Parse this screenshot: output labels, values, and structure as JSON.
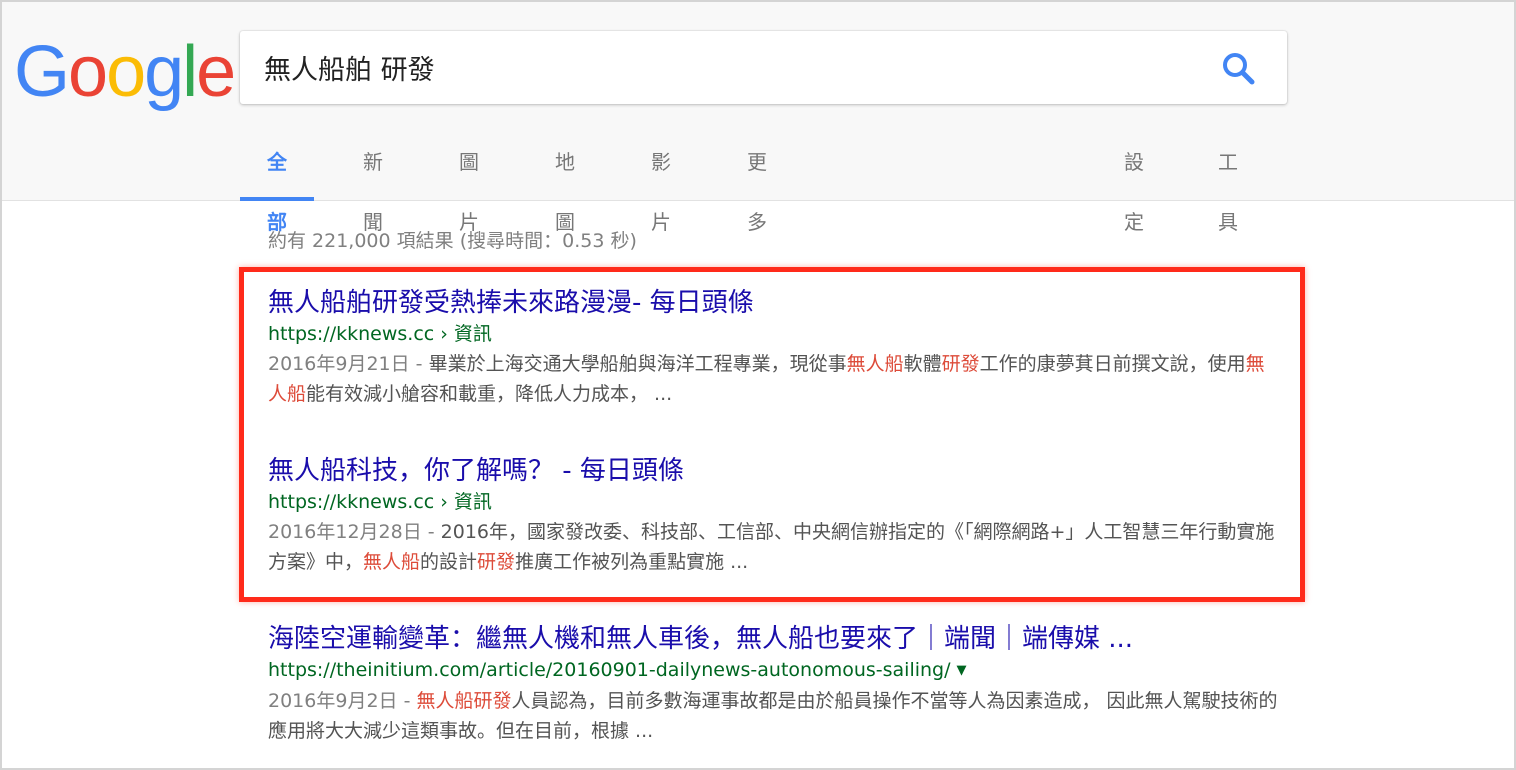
{
  "logo": {
    "letters": [
      {
        "ch": "G",
        "color": "#4285f4"
      },
      {
        "ch": "o",
        "color": "#ea4335"
      },
      {
        "ch": "o",
        "color": "#fbbc05"
      },
      {
        "ch": "g",
        "color": "#4285f4"
      },
      {
        "ch": "l",
        "color": "#34a853"
      },
      {
        "ch": "e",
        "color": "#ea4335"
      }
    ]
  },
  "search": {
    "query": "無人船舶 研發",
    "icon": "search-icon",
    "icon_color": "#4285f4"
  },
  "tabs": {
    "all": "全部",
    "news": "新聞",
    "images": "圖片",
    "maps": "地圖",
    "videos": "影片",
    "more": "更多",
    "settings": "設定",
    "tools": "工具"
  },
  "stats": "約有 221,000 項結果 (搜尋時間：0.53 秒)",
  "results": [
    {
      "title": "無人船舶研發受熱捧未來路漫漫- 每日頭條",
      "url": "https://kknews.cc › 資訊",
      "date": "2016年9月21日",
      "date_sep": " - ",
      "snippet": [
        {
          "t": "畢業於上海交通大學船舶與海洋工程專業，現從事",
          "hl": false
        },
        {
          "t": "無人船",
          "hl": true
        },
        {
          "t": "軟體",
          "hl": false
        },
        {
          "t": "研發",
          "hl": true
        },
        {
          "t": "工作的康夢萁日前撰文說，使用",
          "hl": false
        },
        {
          "t": "無人船",
          "hl": true
        },
        {
          "t": "能有效減小艙容和載重，降低人力成本， ...",
          "hl": false
        }
      ]
    },
    {
      "title": "無人船科技，你了解嗎？ - 每日頭條",
      "url": "https://kknews.cc › 資訊",
      "date": "2016年12月28日",
      "date_sep": " - ",
      "snippet": [
        {
          "t": "2016年，國家發改委、科技部、工信部、中央網信辦指定的《「網際網路+」人工智慧三年行動實施方案》中，",
          "hl": false
        },
        {
          "t": "無人船",
          "hl": true
        },
        {
          "t": "的設計",
          "hl": false
        },
        {
          "t": "研發",
          "hl": true
        },
        {
          "t": "推廣工作被列為重點實施 ...",
          "hl": false
        }
      ]
    },
    {
      "title": "海陸空運輸變革：繼無人機和無人車後，無人船也要來了｜端聞｜端傳媒 ...",
      "url": "https://theinitium.com/article/20160901-dailynews-autonomous-sailing/",
      "url_arrow": "▼",
      "date": "2016年9月2日",
      "date_sep": " - ",
      "snippet": [
        {
          "t": "無人船研發",
          "hl": true
        },
        {
          "t": "人員認為，目前多數海運事故都是由於船員操作不當等人為因素造成， 因此無人駕駛技術的應用將大大減少這類事故。但在目前，根據 ...",
          "hl": false
        }
      ]
    }
  ],
  "colors": {
    "link": "#1a0dab",
    "url": "#006621",
    "highlight_box": "#ff2a1a",
    "keyword": "#dd4b39"
  }
}
